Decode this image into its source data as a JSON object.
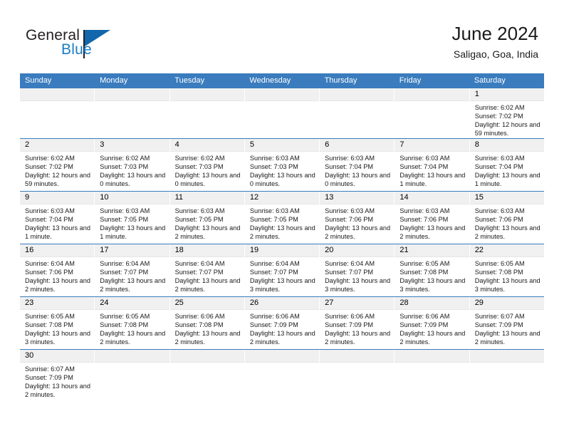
{
  "logo": {
    "word1": "General",
    "word2": "Blue",
    "triangle_color": "#1266ab",
    "blue_text_color": "#1a7dc4"
  },
  "header": {
    "title": "June 2024",
    "subtitle": "Saligao, Goa, India"
  },
  "theme": {
    "header_blue": "#3a7cbe",
    "day_band_gray": "#f0f0f0"
  },
  "weekdays": [
    "Sunday",
    "Monday",
    "Tuesday",
    "Wednesday",
    "Thursday",
    "Friday",
    "Saturday"
  ],
  "weeks": [
    [
      {
        "empty": true
      },
      {
        "empty": true
      },
      {
        "empty": true
      },
      {
        "empty": true
      },
      {
        "empty": true
      },
      {
        "empty": true
      },
      {
        "day": "1",
        "sunrise": "Sunrise: 6:02 AM",
        "sunset": "Sunset: 7:02 PM",
        "daylight": "Daylight: 12 hours and 59 minutes."
      }
    ],
    [
      {
        "day": "2",
        "sunrise": "Sunrise: 6:02 AM",
        "sunset": "Sunset: 7:02 PM",
        "daylight": "Daylight: 12 hours and 59 minutes."
      },
      {
        "day": "3",
        "sunrise": "Sunrise: 6:02 AM",
        "sunset": "Sunset: 7:03 PM",
        "daylight": "Daylight: 13 hours and 0 minutes."
      },
      {
        "day": "4",
        "sunrise": "Sunrise: 6:02 AM",
        "sunset": "Sunset: 7:03 PM",
        "daylight": "Daylight: 13 hours and 0 minutes."
      },
      {
        "day": "5",
        "sunrise": "Sunrise: 6:03 AM",
        "sunset": "Sunset: 7:03 PM",
        "daylight": "Daylight: 13 hours and 0 minutes."
      },
      {
        "day": "6",
        "sunrise": "Sunrise: 6:03 AM",
        "sunset": "Sunset: 7:04 PM",
        "daylight": "Daylight: 13 hours and 0 minutes."
      },
      {
        "day": "7",
        "sunrise": "Sunrise: 6:03 AM",
        "sunset": "Sunset: 7:04 PM",
        "daylight": "Daylight: 13 hours and 1 minute."
      },
      {
        "day": "8",
        "sunrise": "Sunrise: 6:03 AM",
        "sunset": "Sunset: 7:04 PM",
        "daylight": "Daylight: 13 hours and 1 minute."
      }
    ],
    [
      {
        "day": "9",
        "sunrise": "Sunrise: 6:03 AM",
        "sunset": "Sunset: 7:04 PM",
        "daylight": "Daylight: 13 hours and 1 minute."
      },
      {
        "day": "10",
        "sunrise": "Sunrise: 6:03 AM",
        "sunset": "Sunset: 7:05 PM",
        "daylight": "Daylight: 13 hours and 1 minute."
      },
      {
        "day": "11",
        "sunrise": "Sunrise: 6:03 AM",
        "sunset": "Sunset: 7:05 PM",
        "daylight": "Daylight: 13 hours and 2 minutes."
      },
      {
        "day": "12",
        "sunrise": "Sunrise: 6:03 AM",
        "sunset": "Sunset: 7:05 PM",
        "daylight": "Daylight: 13 hours and 2 minutes."
      },
      {
        "day": "13",
        "sunrise": "Sunrise: 6:03 AM",
        "sunset": "Sunset: 7:06 PM",
        "daylight": "Daylight: 13 hours and 2 minutes."
      },
      {
        "day": "14",
        "sunrise": "Sunrise: 6:03 AM",
        "sunset": "Sunset: 7:06 PM",
        "daylight": "Daylight: 13 hours and 2 minutes."
      },
      {
        "day": "15",
        "sunrise": "Sunrise: 6:03 AM",
        "sunset": "Sunset: 7:06 PM",
        "daylight": "Daylight: 13 hours and 2 minutes."
      }
    ],
    [
      {
        "day": "16",
        "sunrise": "Sunrise: 6:04 AM",
        "sunset": "Sunset: 7:06 PM",
        "daylight": "Daylight: 13 hours and 2 minutes."
      },
      {
        "day": "17",
        "sunrise": "Sunrise: 6:04 AM",
        "sunset": "Sunset: 7:07 PM",
        "daylight": "Daylight: 13 hours and 2 minutes."
      },
      {
        "day": "18",
        "sunrise": "Sunrise: 6:04 AM",
        "sunset": "Sunset: 7:07 PM",
        "daylight": "Daylight: 13 hours and 2 minutes."
      },
      {
        "day": "19",
        "sunrise": "Sunrise: 6:04 AM",
        "sunset": "Sunset: 7:07 PM",
        "daylight": "Daylight: 13 hours and 3 minutes."
      },
      {
        "day": "20",
        "sunrise": "Sunrise: 6:04 AM",
        "sunset": "Sunset: 7:07 PM",
        "daylight": "Daylight: 13 hours and 3 minutes."
      },
      {
        "day": "21",
        "sunrise": "Sunrise: 6:05 AM",
        "sunset": "Sunset: 7:08 PM",
        "daylight": "Daylight: 13 hours and 3 minutes."
      },
      {
        "day": "22",
        "sunrise": "Sunrise: 6:05 AM",
        "sunset": "Sunset: 7:08 PM",
        "daylight": "Daylight: 13 hours and 3 minutes."
      }
    ],
    [
      {
        "day": "23",
        "sunrise": "Sunrise: 6:05 AM",
        "sunset": "Sunset: 7:08 PM",
        "daylight": "Daylight: 13 hours and 3 minutes."
      },
      {
        "day": "24",
        "sunrise": "Sunrise: 6:05 AM",
        "sunset": "Sunset: 7:08 PM",
        "daylight": "Daylight: 13 hours and 2 minutes."
      },
      {
        "day": "25",
        "sunrise": "Sunrise: 6:06 AM",
        "sunset": "Sunset: 7:08 PM",
        "daylight": "Daylight: 13 hours and 2 minutes."
      },
      {
        "day": "26",
        "sunrise": "Sunrise: 6:06 AM",
        "sunset": "Sunset: 7:09 PM",
        "daylight": "Daylight: 13 hours and 2 minutes."
      },
      {
        "day": "27",
        "sunrise": "Sunrise: 6:06 AM",
        "sunset": "Sunset: 7:09 PM",
        "daylight": "Daylight: 13 hours and 2 minutes."
      },
      {
        "day": "28",
        "sunrise": "Sunrise: 6:06 AM",
        "sunset": "Sunset: 7:09 PM",
        "daylight": "Daylight: 13 hours and 2 minutes."
      },
      {
        "day": "29",
        "sunrise": "Sunrise: 6:07 AM",
        "sunset": "Sunset: 7:09 PM",
        "daylight": "Daylight: 13 hours and 2 minutes."
      }
    ],
    [
      {
        "day": "30",
        "sunrise": "Sunrise: 6:07 AM",
        "sunset": "Sunset: 7:09 PM",
        "daylight": "Daylight: 13 hours and 2 minutes."
      },
      {
        "empty": true
      },
      {
        "empty": true
      },
      {
        "empty": true
      },
      {
        "empty": true
      },
      {
        "empty": true
      },
      {
        "empty": true
      }
    ]
  ]
}
